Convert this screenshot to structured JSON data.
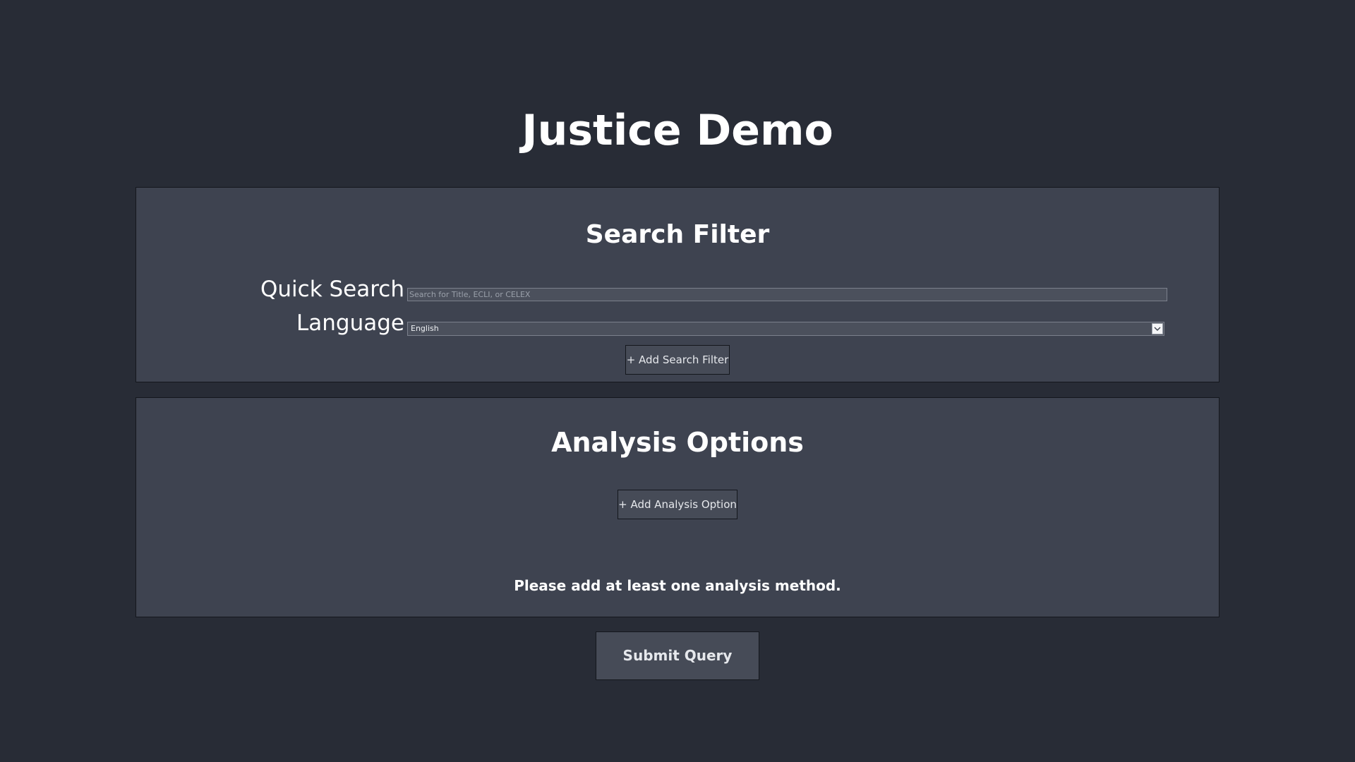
{
  "app": {
    "title": "Justice Demo"
  },
  "search_filter": {
    "heading": "Search Filter",
    "quick_search": {
      "label": "Quick Search",
      "value": "",
      "placeholder": "Search for Title, ECLI, or CELEX"
    },
    "language": {
      "label": "Language",
      "selected": "English",
      "icon": "chevron-down-icon"
    },
    "add_button_label": "+ Add Search Filter"
  },
  "analysis_options": {
    "heading": "Analysis Options",
    "add_button_label": "+ Add Analysis Option",
    "notice": "Please add at least one analysis method."
  },
  "submit": {
    "label": "Submit Query"
  },
  "colors": {
    "page_background": "#282c36",
    "panel_background": "#3e4350",
    "button_background": "#464b57",
    "text": "#ffffff"
  }
}
